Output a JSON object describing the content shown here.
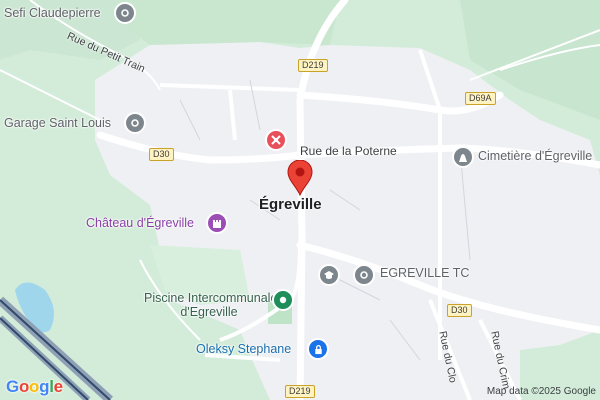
{
  "map": {
    "roads": {
      "d219_north": "D219",
      "d219_south": "D219",
      "d30_west": "D30",
      "d30_east": "D30",
      "d69a": "D69A"
    },
    "streets": {
      "rue_petit_train": "Rue du Petit Train",
      "rue_poterne": "Rue de la Poterne",
      "rue_du_clo": "Rue du Clo",
      "rue_du_crim": "Rue du Crim"
    },
    "town": "Égreville",
    "pois": {
      "sefi": "Sefi Claudepierre",
      "garage": "Garage Saint Louis",
      "chateau": "Château d'Égreville",
      "cimetiere": "Cimetière d'Égreville",
      "egreville_tc": "EGREVILLE TC",
      "piscine_line1": "Piscine Intercommunale",
      "piscine_line2": "d'Egreville",
      "oleksy": "Oleksy Stephane"
    },
    "attribution": "Map data ©2025 Google",
    "logo": "Google"
  },
  "icons": {
    "sefi": "location-icon",
    "garage": "location-icon",
    "chateau": "castle-icon",
    "restaurant": "restaurant-icon",
    "cimetiere": "cemetery-icon",
    "egreville_tc": "school-icon",
    "piscine": "pool-icon",
    "oleksy": "lock-icon",
    "marker": "red-marker-icon"
  },
  "colors": {
    "greenery": "#cde9d4",
    "urban": "#eef0f3",
    "road": "#ffffff",
    "marker": "#ea4335",
    "purple": "#9b4fb5",
    "teal": "#1e8e5a",
    "blue": "#1a73e8",
    "grey": "#7c868c"
  }
}
